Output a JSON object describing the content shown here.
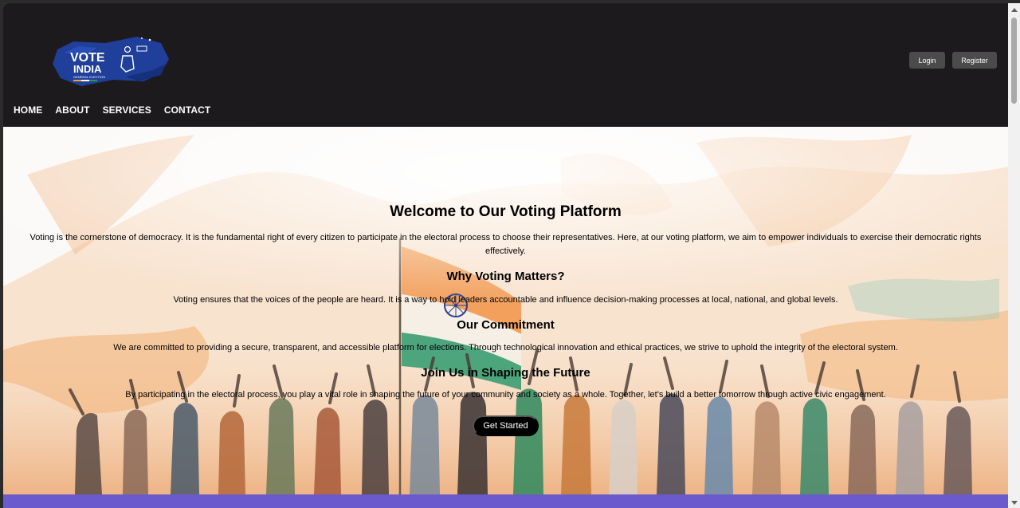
{
  "logo": {
    "text_line1": "VOTE",
    "text_line2": "INDIA",
    "subtitle": "GENERAL ELECTION"
  },
  "header": {
    "login_label": "Login",
    "register_label": "Register"
  },
  "nav": {
    "items": [
      "HOME",
      "ABOUT",
      "SERVICES",
      "CONTACT"
    ]
  },
  "main": {
    "title": "Welcome to Our Voting Platform",
    "intro": "Voting is the cornerstone of democracy. It is the fundamental right of every citizen to participate in the electoral process to choose their representatives. Here, at our voting platform, we aim to empower individuals to exercise their democratic rights effectively.",
    "sections": [
      {
        "heading": "Why Voting Matters?",
        "text": "Voting ensures that the voices of the people are heard. It is a way to hold leaders accountable and influence decision-making processes at local, national, and global levels."
      },
      {
        "heading": "Our Commitment",
        "text": "We are committed to providing a secure, transparent, and accessible platform for elections. Through technological innovation and ethical practices, we strive to uphold the integrity of the electoral system."
      },
      {
        "heading": "Join Us in Shaping the Future",
        "text": "By participating in the electoral process, you play a vital role in shaping the future of your community and society as a whole. Together, let's build a better tomorrow through active civic engagement."
      }
    ],
    "cta_label": "Get Started"
  },
  "colors": {
    "header_bg": "#1c1a1c",
    "accent": "#6a5acd",
    "saffron": "#f4a45a",
    "green": "#3a9a6a"
  }
}
